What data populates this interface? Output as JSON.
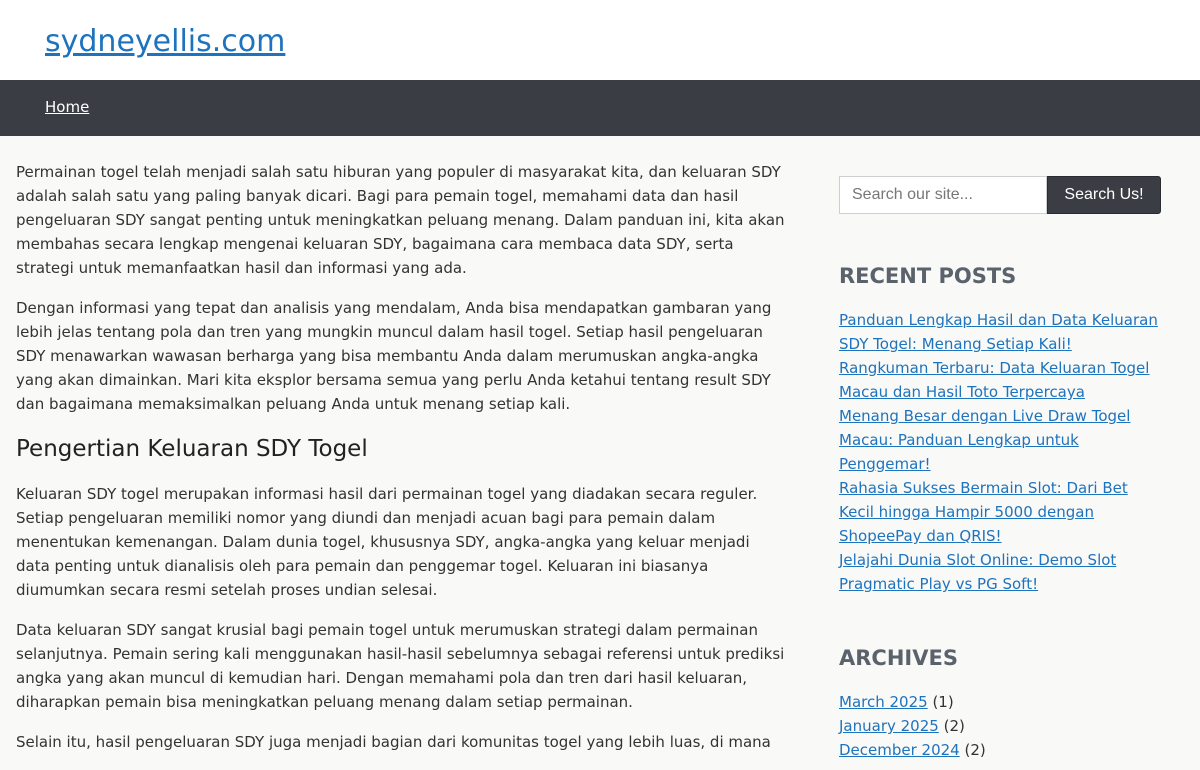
{
  "header": {
    "site_title": "sydneyellis.com"
  },
  "nav": {
    "items": [
      {
        "label": "Home"
      }
    ]
  },
  "main": {
    "paragraphs_intro": [
      "Permainan togel telah menjadi salah satu hiburan yang populer di masyarakat kita, dan keluaran SDY adalah salah satu yang paling banyak dicari. Bagi para pemain togel, memahami data dan hasil pengeluaran SDY sangat penting untuk meningkatkan peluang menang. Dalam panduan ini, kita akan membahas secara lengkap mengenai keluaran SDY, bagaimana cara membaca data SDY, serta strategi untuk memanfaatkan hasil dan informasi yang ada.",
      "Dengan informasi yang tepat dan analisis yang mendalam, Anda bisa mendapatkan gambaran yang lebih jelas tentang pola dan tren yang mungkin muncul dalam hasil togel. Setiap hasil pengeluaran SDY menawarkan wawasan berharga yang bisa membantu Anda dalam merumuskan angka-angka yang akan dimainkan. Mari kita eksplor bersama semua yang perlu Anda ketahui tentang result SDY dan bagaimana memaksimalkan peluang Anda untuk menang setiap kali."
    ],
    "heading": "Pengertian Keluaran SDY Togel",
    "paragraphs_section": [
      "Keluaran SDY togel merupakan informasi hasil dari permainan togel yang diadakan secara reguler. Setiap pengeluaran memiliki nomor yang diundi dan menjadi acuan bagi para pemain dalam menentukan kemenangan. Dalam dunia togel, khususnya SDY, angka-angka yang keluar menjadi data penting untuk dianalisis oleh para pemain dan penggemar togel. Keluaran ini biasanya diumumkan secara resmi setelah proses undian selesai.",
      "Data keluaran SDY sangat krusial bagi pemain togel untuk merumuskan strategi dalam permainan selanjutnya. Pemain sering kali menggunakan hasil-hasil sebelumnya sebagai referensi untuk prediksi angka yang akan muncul di kemudian hari. Dengan memahami pola dan tren dari hasil keluaran, diharapkan pemain bisa meningkatkan peluang menang dalam setiap permainan.",
      "Selain itu, hasil pengeluaran SDY juga menjadi bagian dari komunitas togel yang lebih luas, di mana"
    ]
  },
  "sidebar": {
    "search": {
      "placeholder": "Search our site...",
      "button_label": "Search Us!"
    },
    "recent_posts": {
      "title": "RECENT POSTS",
      "items": [
        "Panduan Lengkap Hasil dan Data Keluaran SDY Togel: Menang Setiap Kali!",
        "Rangkuman Terbaru: Data Keluaran Togel Macau dan Hasil Toto Terpercaya",
        "Menang Besar dengan Live Draw Togel Macau: Panduan Lengkap untuk Penggemar!",
        "Rahasia Sukses Bermain Slot: Dari Bet Kecil hingga Hampir 5000 dengan ShopeePay dan QRIS!",
        "Jelajahi Dunia Slot Online: Demo Slot Pragmatic Play vs PG Soft!"
      ]
    },
    "archives": {
      "title": "ARCHIVES",
      "items": [
        {
          "label": "March 2025",
          "count": "(1)"
        },
        {
          "label": "January 2025",
          "count": "(2)"
        },
        {
          "label": "December 2024",
          "count": "(2)"
        }
      ]
    }
  }
}
